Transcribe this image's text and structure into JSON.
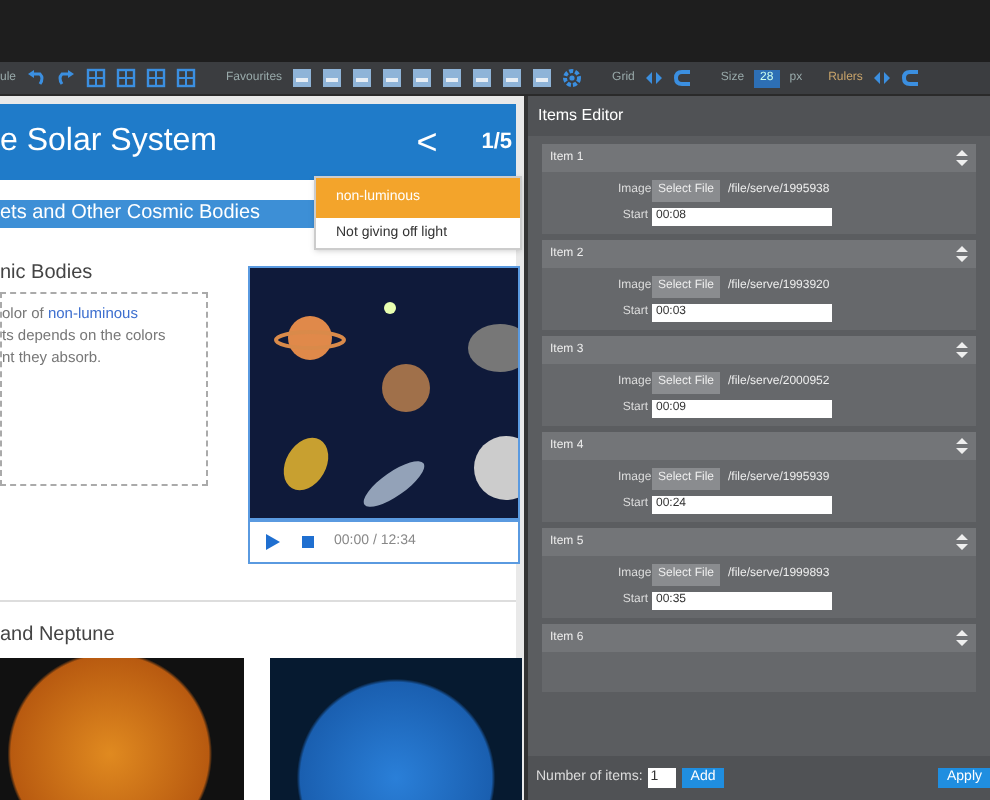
{
  "toolbar": {
    "module_label": "ule",
    "favourites_label": "Favourites",
    "grid_label": "Grid",
    "size_label": "Size",
    "size_value": "28",
    "size_unit": "px",
    "rulers_label": "Rulers"
  },
  "slide": {
    "title": "e Solar System",
    "back": "<",
    "page": "1/5",
    "subtitle": "ets and Other Cosmic Bodies",
    "section_heading": "nic Bodies",
    "text_lines": [
      {
        "text": "olor of",
        "term": "non-luminous"
      },
      {
        "text": "ts depends on the colors"
      },
      {
        "text": "nt they absorb."
      }
    ],
    "tooltip": {
      "term": "non-luminous",
      "definition": "Not giving off light"
    },
    "player": {
      "time": "00:00 / 12:34"
    },
    "section2_heading": "and Neptune"
  },
  "items_editor": {
    "title": "Items Editor",
    "items": [
      {
        "label": "Item 1",
        "image_label": "Image",
        "button": "Select File",
        "file": "/file/serve/1995938",
        "start_label": "Start",
        "start": "00:08"
      },
      {
        "label": "Item 2",
        "image_label": "Image",
        "button": "Select File",
        "file": "/file/serve/1993920",
        "start_label": "Start",
        "start": "00:03"
      },
      {
        "label": "Item 3",
        "image_label": "Image",
        "button": "Select File",
        "file": "/file/serve/2000952",
        "start_label": "Start",
        "start": "00:09"
      },
      {
        "label": "Item 4",
        "image_label": "Image",
        "button": "Select File",
        "file": "/file/serve/1995939",
        "start_label": "Start",
        "start": "00:24"
      },
      {
        "label": "Item 5",
        "image_label": "Image",
        "button": "Select File",
        "file": "/file/serve/1999893",
        "start_label": "Start",
        "start": "00:35"
      },
      {
        "label": "Item 6"
      }
    ],
    "count_label": "Number of items:",
    "count": "1",
    "add": "Add",
    "apply": "Apply"
  }
}
